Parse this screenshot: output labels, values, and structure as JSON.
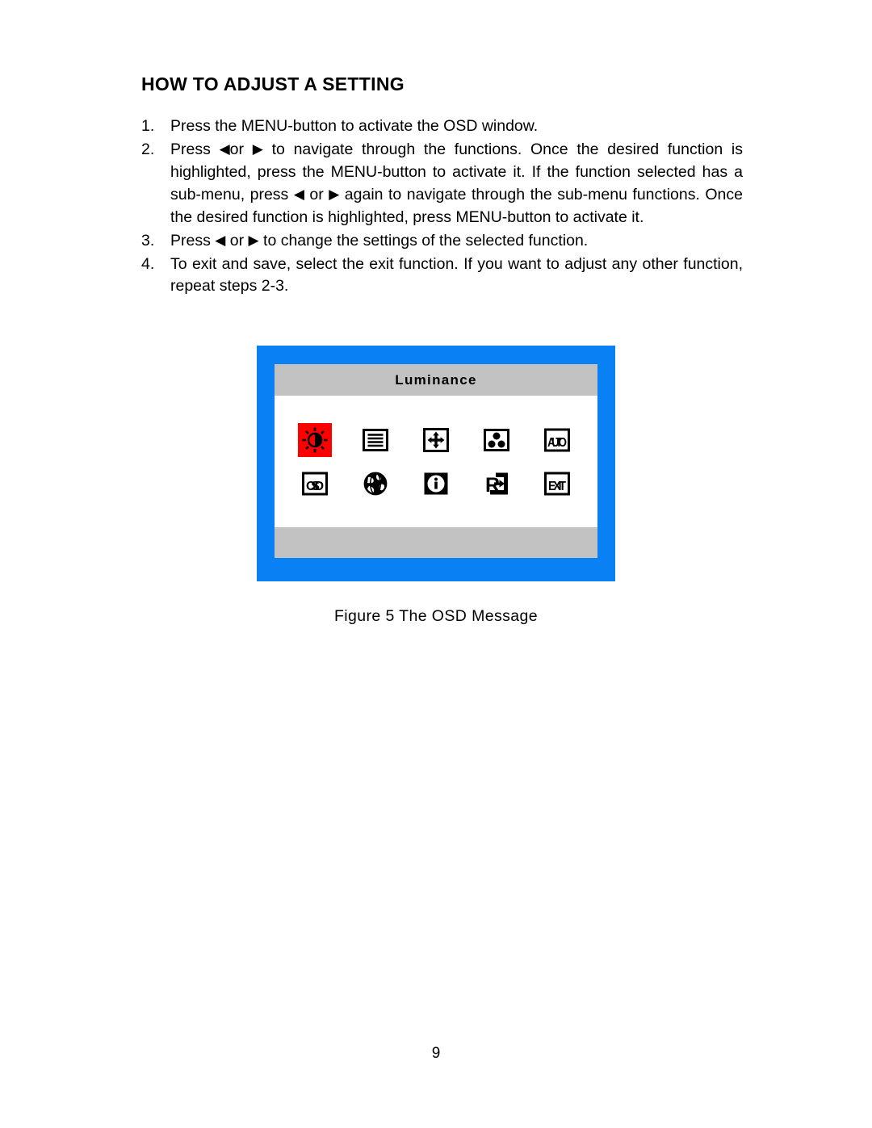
{
  "page": {
    "number": "9"
  },
  "heading": {
    "title": "HOW TO ADJUST A SETTING"
  },
  "steps": [
    {
      "num": "1.",
      "parts": [
        {
          "type": "text",
          "value": "Press the MENU-button to activate the OSD window."
        }
      ]
    },
    {
      "num": "2.",
      "parts": [
        {
          "type": "text",
          "value": "Press "
        },
        {
          "type": "icon",
          "value": "left-arrow-icon",
          "glyph": "◀"
        },
        {
          "type": "text",
          "value": "or "
        },
        {
          "type": "icon",
          "value": "right-arrow-icon",
          "glyph": "▶"
        },
        {
          "type": "text",
          "value": " to navigate through the functions. Once the desired function is highlighted, press the MENU-button  to activate it.  If the function selected has a sub-menu, press "
        },
        {
          "type": "icon",
          "value": "left-arrow-icon",
          "glyph": "◀"
        },
        {
          "type": "text",
          "value": " or "
        },
        {
          "type": "icon",
          "value": "right-arrow-icon",
          "glyph": "▶"
        },
        {
          "type": "text",
          "value": " again to navigate through the sub-menu functions.   Once the desired function is highlighted, press MENU-button to activate it."
        }
      ]
    },
    {
      "num": "3.",
      "parts": [
        {
          "type": "text",
          "value": "Press "
        },
        {
          "type": "icon",
          "value": "left-arrow-icon",
          "glyph": "◀"
        },
        {
          "type": "text",
          "value": " or "
        },
        {
          "type": "icon",
          "value": "right-arrow-icon",
          "glyph": "▶"
        },
        {
          "type": "text",
          "value": " to change the settings of the selected function."
        }
      ]
    },
    {
      "num": "4.",
      "parts": [
        {
          "type": "text",
          "value": "To exit and save, select the exit function. If you want to adjust any other function, repeat steps 2-3."
        }
      ]
    }
  ],
  "osd": {
    "title": "Luminance",
    "border_color": "#0a80f5",
    "bar_color": "#c2c2c2",
    "panel_color": "#ffffff",
    "highlight_color": "#ff0000",
    "rows": [
      [
        {
          "name": "luminance-icon",
          "label": "Luminance",
          "selected": true
        },
        {
          "name": "image-setup-icon",
          "label": "Image Setup",
          "selected": false
        },
        {
          "name": "position-icon",
          "label": "Position",
          "selected": false
        },
        {
          "name": "color-temp-icon",
          "label": "Color Temperature",
          "selected": false
        },
        {
          "name": "auto-icon",
          "label": "AUTO",
          "selected": false
        }
      ],
      [
        {
          "name": "osd-setup-icon",
          "label": "OSD",
          "selected": false
        },
        {
          "name": "language-globe-icon",
          "label": "Language",
          "selected": false
        },
        {
          "name": "information-icon",
          "label": "Information",
          "selected": false
        },
        {
          "name": "reset-icon",
          "label": "Reset",
          "selected": false
        },
        {
          "name": "exit-icon",
          "label": "EXIT",
          "selected": false
        }
      ]
    ]
  },
  "figure": {
    "caption": "Figure 5    The  OSD  Message"
  }
}
